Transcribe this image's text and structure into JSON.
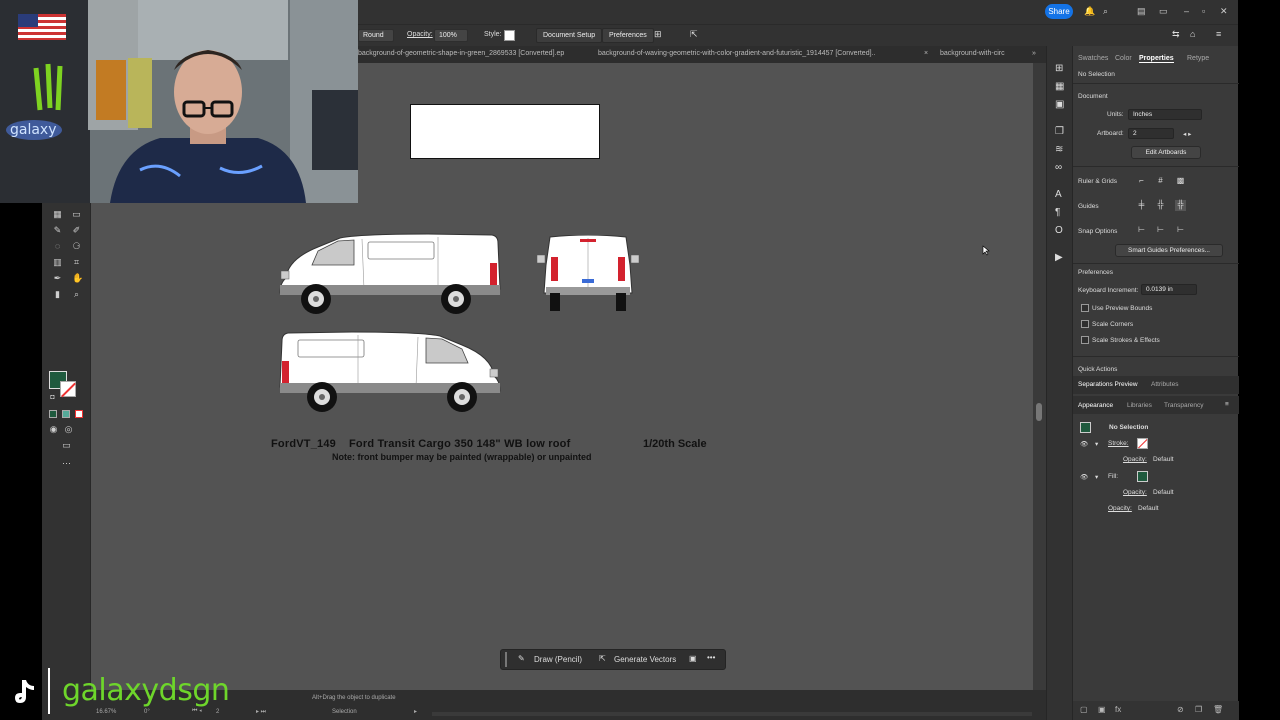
{
  "topbar": {
    "share_label": "Share"
  },
  "control_bar": {
    "stroke_profile": "Round",
    "opacity_label": "Opacity:",
    "opacity_value": "100%",
    "style_label": "Style:",
    "doc_setup_label": "Document Setup",
    "preferences_label": "Preferences"
  },
  "tabs": [
    "background-of-geometric-shape-in-green_2869533 [Converted].ep",
    "background-of-waving-geometric-with-color-gradient-and-futuristic_1914457 [Converted]..",
    "background-with-circ"
  ],
  "canvas": {
    "line1_code": "FordVT_149",
    "line1_desc": "Ford Transit Cargo 350  148\" WB low roof",
    "line1_scale": "1/20th Scale",
    "line2": "Note: front bumper may be painted (wrappable) or unpainted"
  },
  "floatbar": {
    "draw_label": "Draw (Pencil)",
    "generate_label": "Generate Vectors"
  },
  "status": {
    "hint": "Alt+Drag the object to duplicate",
    "zoom": "16.67%",
    "angle": "0°",
    "artboard_num": "2",
    "tool": "Selection"
  },
  "right_panel": {
    "tabs": [
      "Swatches",
      "Color",
      "Properties",
      "Retype"
    ],
    "selection": "No Selection",
    "document_heading": "Document",
    "units_label": "Units:",
    "units_value": "Inches",
    "artboard_label": "Artboard:",
    "artboard_value": "2",
    "edit_artboards": "Edit Artboards",
    "rulers_label": "Ruler & Grids",
    "guides_label": "Guides",
    "snap_label": "Snap Options",
    "smart_guides": "Smart Guides Preferences...",
    "preferences_heading": "Preferences",
    "keyboard_label": "Keyboard Increment:",
    "keyboard_value": "0.0139 in",
    "use_preview": "Use Preview Bounds",
    "scale_corners": "Scale Corners",
    "scale_strokes": "Scale Strokes & Effects",
    "quick_actions": "Quick Actions",
    "sep_tabs": [
      "Separations Preview",
      "Attributes"
    ],
    "app_tabs": [
      "Appearance",
      "Libraries",
      "Transparency"
    ],
    "app_selection": "No Selection",
    "stroke_label": "Stroke:",
    "opacity1_label": "Opacity:",
    "opacity1_value": "Default",
    "fill_label": "Fill:",
    "opacity2_label": "Opacity:",
    "opacity2_value": "Default",
    "opacity3_label": "Opacity:",
    "opacity3_value": "Default"
  },
  "overlay": {
    "tiktok_handle": "galaxydsgn",
    "cap_text": "galaxy"
  },
  "colors": {
    "fill_swatch": "#1f5a3e",
    "stroke_swatch": "#ffffff",
    "accent": "#1473e6",
    "tiktok_green": "#6ed62b"
  }
}
